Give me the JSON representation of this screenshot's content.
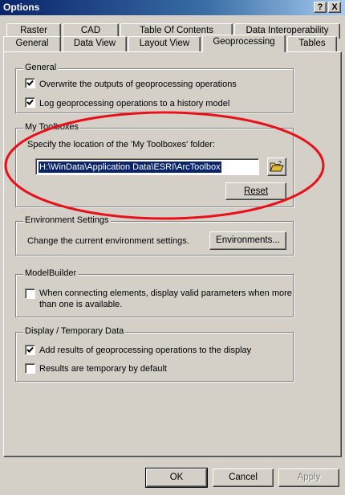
{
  "window": {
    "title": "Options"
  },
  "title_buttons": {
    "help": "?",
    "close": "X"
  },
  "tabs_back": [
    "Raster",
    "CAD",
    "Table Of Contents",
    "Data Interoperability"
  ],
  "tabs_front": [
    "General",
    "Data View",
    "Layout View",
    "Geoprocessing",
    "Tables"
  ],
  "active_tab": "Geoprocessing",
  "general": {
    "legend": "General",
    "overwrite_label": "Overwrite the outputs of geoprocessing operations",
    "overwrite_checked": true,
    "log_label": "Log geoprocessing operations to a history model",
    "log_checked": true
  },
  "my_toolboxes": {
    "legend": "My Toolboxes",
    "instruction": "Specify the location of the 'My Toolboxes' folder:",
    "path_value": "H:\\WinData\\Application Data\\ESRI\\ArcToolbox",
    "reset_label": "Reset"
  },
  "environment": {
    "legend": "Environment Settings",
    "description": "Change the current environment settings.",
    "button_label": "Environments..."
  },
  "modelbuilder": {
    "legend": "ModelBuilder",
    "checkbox_label_line1": "When connecting elements, display valid parameters when more",
    "checkbox_label_line2": "than one is available.",
    "checked": false
  },
  "display": {
    "legend": "Display / Temporary Data",
    "add_results_label": "Add results of geoprocessing operations to the display",
    "add_results_checked": true,
    "temporary_label": "Results are temporary by default",
    "temporary_checked": false
  },
  "footer": {
    "ok": "OK",
    "cancel": "Cancel",
    "apply": "Apply"
  },
  "colors": {
    "annotation_ellipse": "#e8101a",
    "selection": "#0a246a",
    "titlebar": "#0a246a"
  }
}
